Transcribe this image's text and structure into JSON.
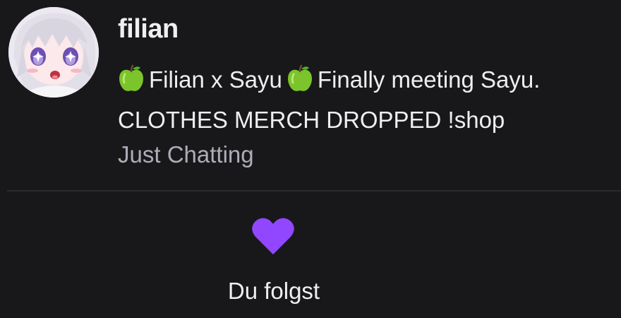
{
  "channel": {
    "name": "filian",
    "avatar_icon": "anime-avatar",
    "title_part1": "Filian x Sayu",
    "title_part2": "Finally meeting Sayu.",
    "title_line2": "CLOTHES MERCH DROPPED !shop",
    "title_emoji": "green-apple",
    "category": "Just Chatting"
  },
  "follow": {
    "label": "Du folgst",
    "icon": "heart-icon",
    "state": "following"
  },
  "colors": {
    "background": "#18181b",
    "text": "#efeff1",
    "muted_text": "#adadb8",
    "accent": "#9147ff",
    "divider": "#2a2a2e"
  }
}
